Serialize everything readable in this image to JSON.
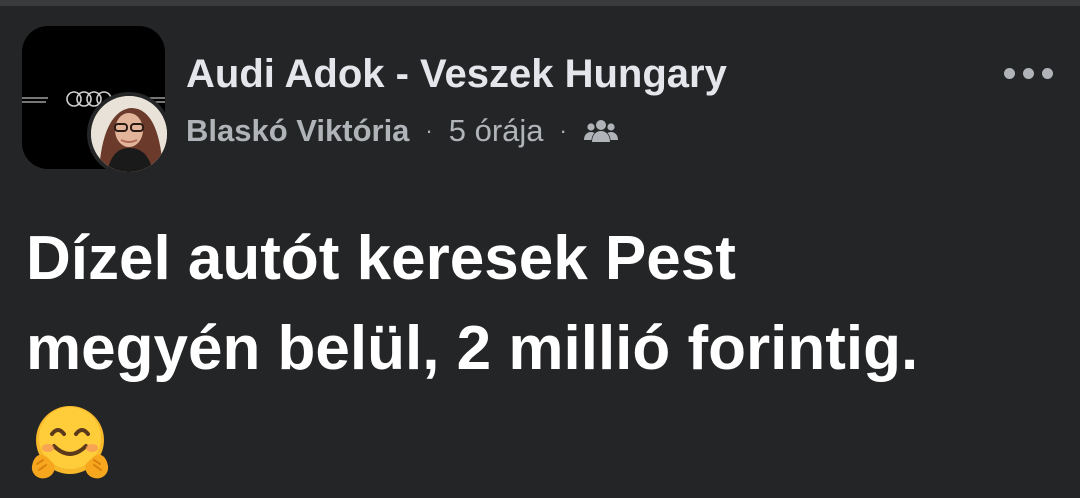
{
  "post": {
    "group_name": "Audi Adok - Veszek Hungary",
    "author": "Blaskó Viktória",
    "separator": "·",
    "time": "5 órája",
    "audience_icon": "group-icon",
    "more_icon": "more-options-icon",
    "text_line1": "Dízel autót keresek Pest",
    "text_line2": "megyén belül, 2 millió forintig.",
    "emoji": "hugging-face-emoji"
  },
  "colors": {
    "background": "#242526",
    "primary_text": "#e4e6eb",
    "secondary_text": "#b0b3b8",
    "post_text": "#ffffff"
  }
}
